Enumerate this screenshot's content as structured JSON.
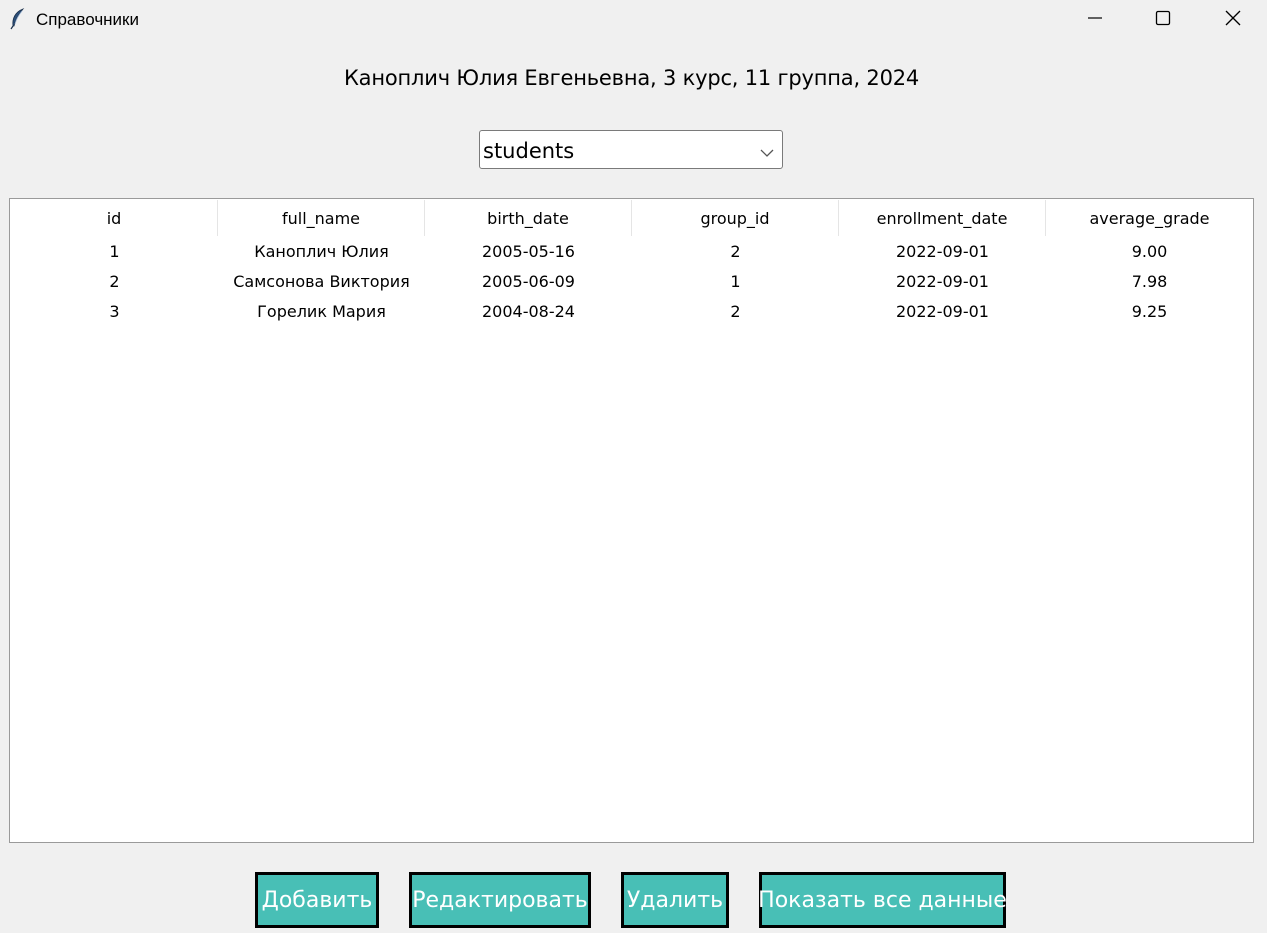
{
  "window": {
    "title": "Справочники",
    "controls": [
      "minimize",
      "maximize",
      "close"
    ]
  },
  "header": {
    "text": "Каноплич Юлия Евгеньевна, 3 курс, 11 группа, 2024"
  },
  "table_select": {
    "selected": "students"
  },
  "table": {
    "columns": [
      "id",
      "full_name",
      "birth_date",
      "group_id",
      "enrollment_date",
      "average_grade"
    ],
    "rows": [
      [
        "1",
        "Каноплич Юлия",
        "2005-05-16",
        "2",
        "2022-09-01",
        "9.00"
      ],
      [
        "2",
        "Самсонова Виктория",
        "2005-06-09",
        "1",
        "2022-09-01",
        "7.98"
      ],
      [
        "3",
        "Горелик Мария",
        "2004-08-24",
        "2",
        "2022-09-01",
        "9.25"
      ]
    ]
  },
  "buttons": {
    "add": "Добавить",
    "edit": "Редактировать",
    "delete": "Удалить",
    "show_all": "Показать все данные"
  },
  "colors": {
    "button_bg": "#48bfb6",
    "window_bg": "#f0f0f0"
  },
  "icons": {
    "app": "feather-icon",
    "minimize": "minimize-icon",
    "maximize": "maximize-icon",
    "close": "close-icon",
    "dropdown": "chevron-down-icon"
  }
}
